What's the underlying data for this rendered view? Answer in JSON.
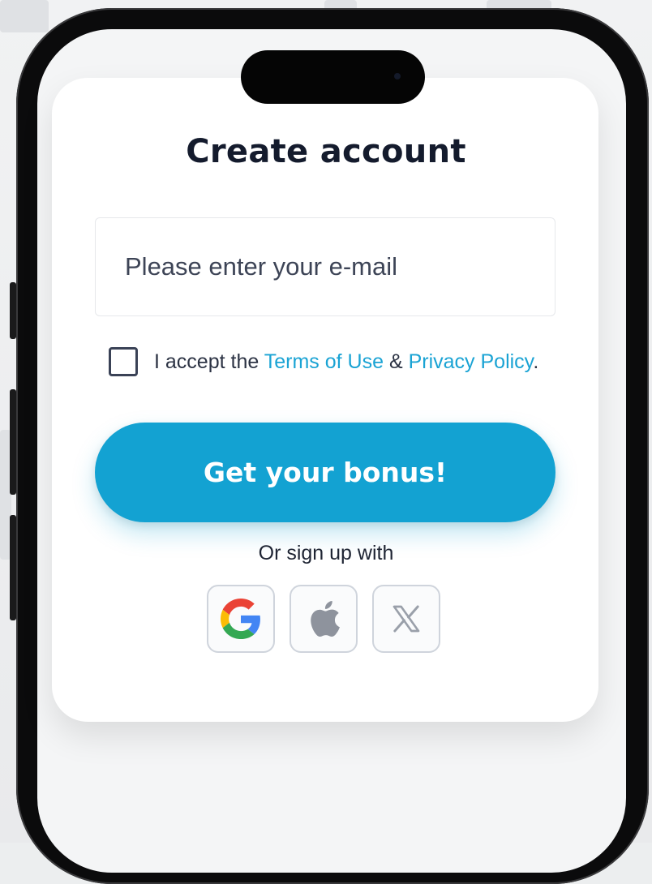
{
  "signup": {
    "title": "Create account",
    "email_placeholder": "Please enter your e-mail",
    "consent": {
      "prefix": "I accept the ",
      "terms_link": "Terms of Use",
      "separator": " & ",
      "privacy_link": "Privacy Policy",
      "suffix": "."
    },
    "cta_label": "Get your bonus!",
    "social_heading": "Or sign up with",
    "social_providers": [
      {
        "icon": "google-icon"
      },
      {
        "icon": "apple-icon"
      },
      {
        "icon": "x-icon"
      }
    ]
  },
  "colors": {
    "accent": "#13a2d2",
    "link": "#1aa3d4",
    "title": "#141b2d",
    "card": "#ffffff",
    "device_frame": "#0b0b0c"
  }
}
